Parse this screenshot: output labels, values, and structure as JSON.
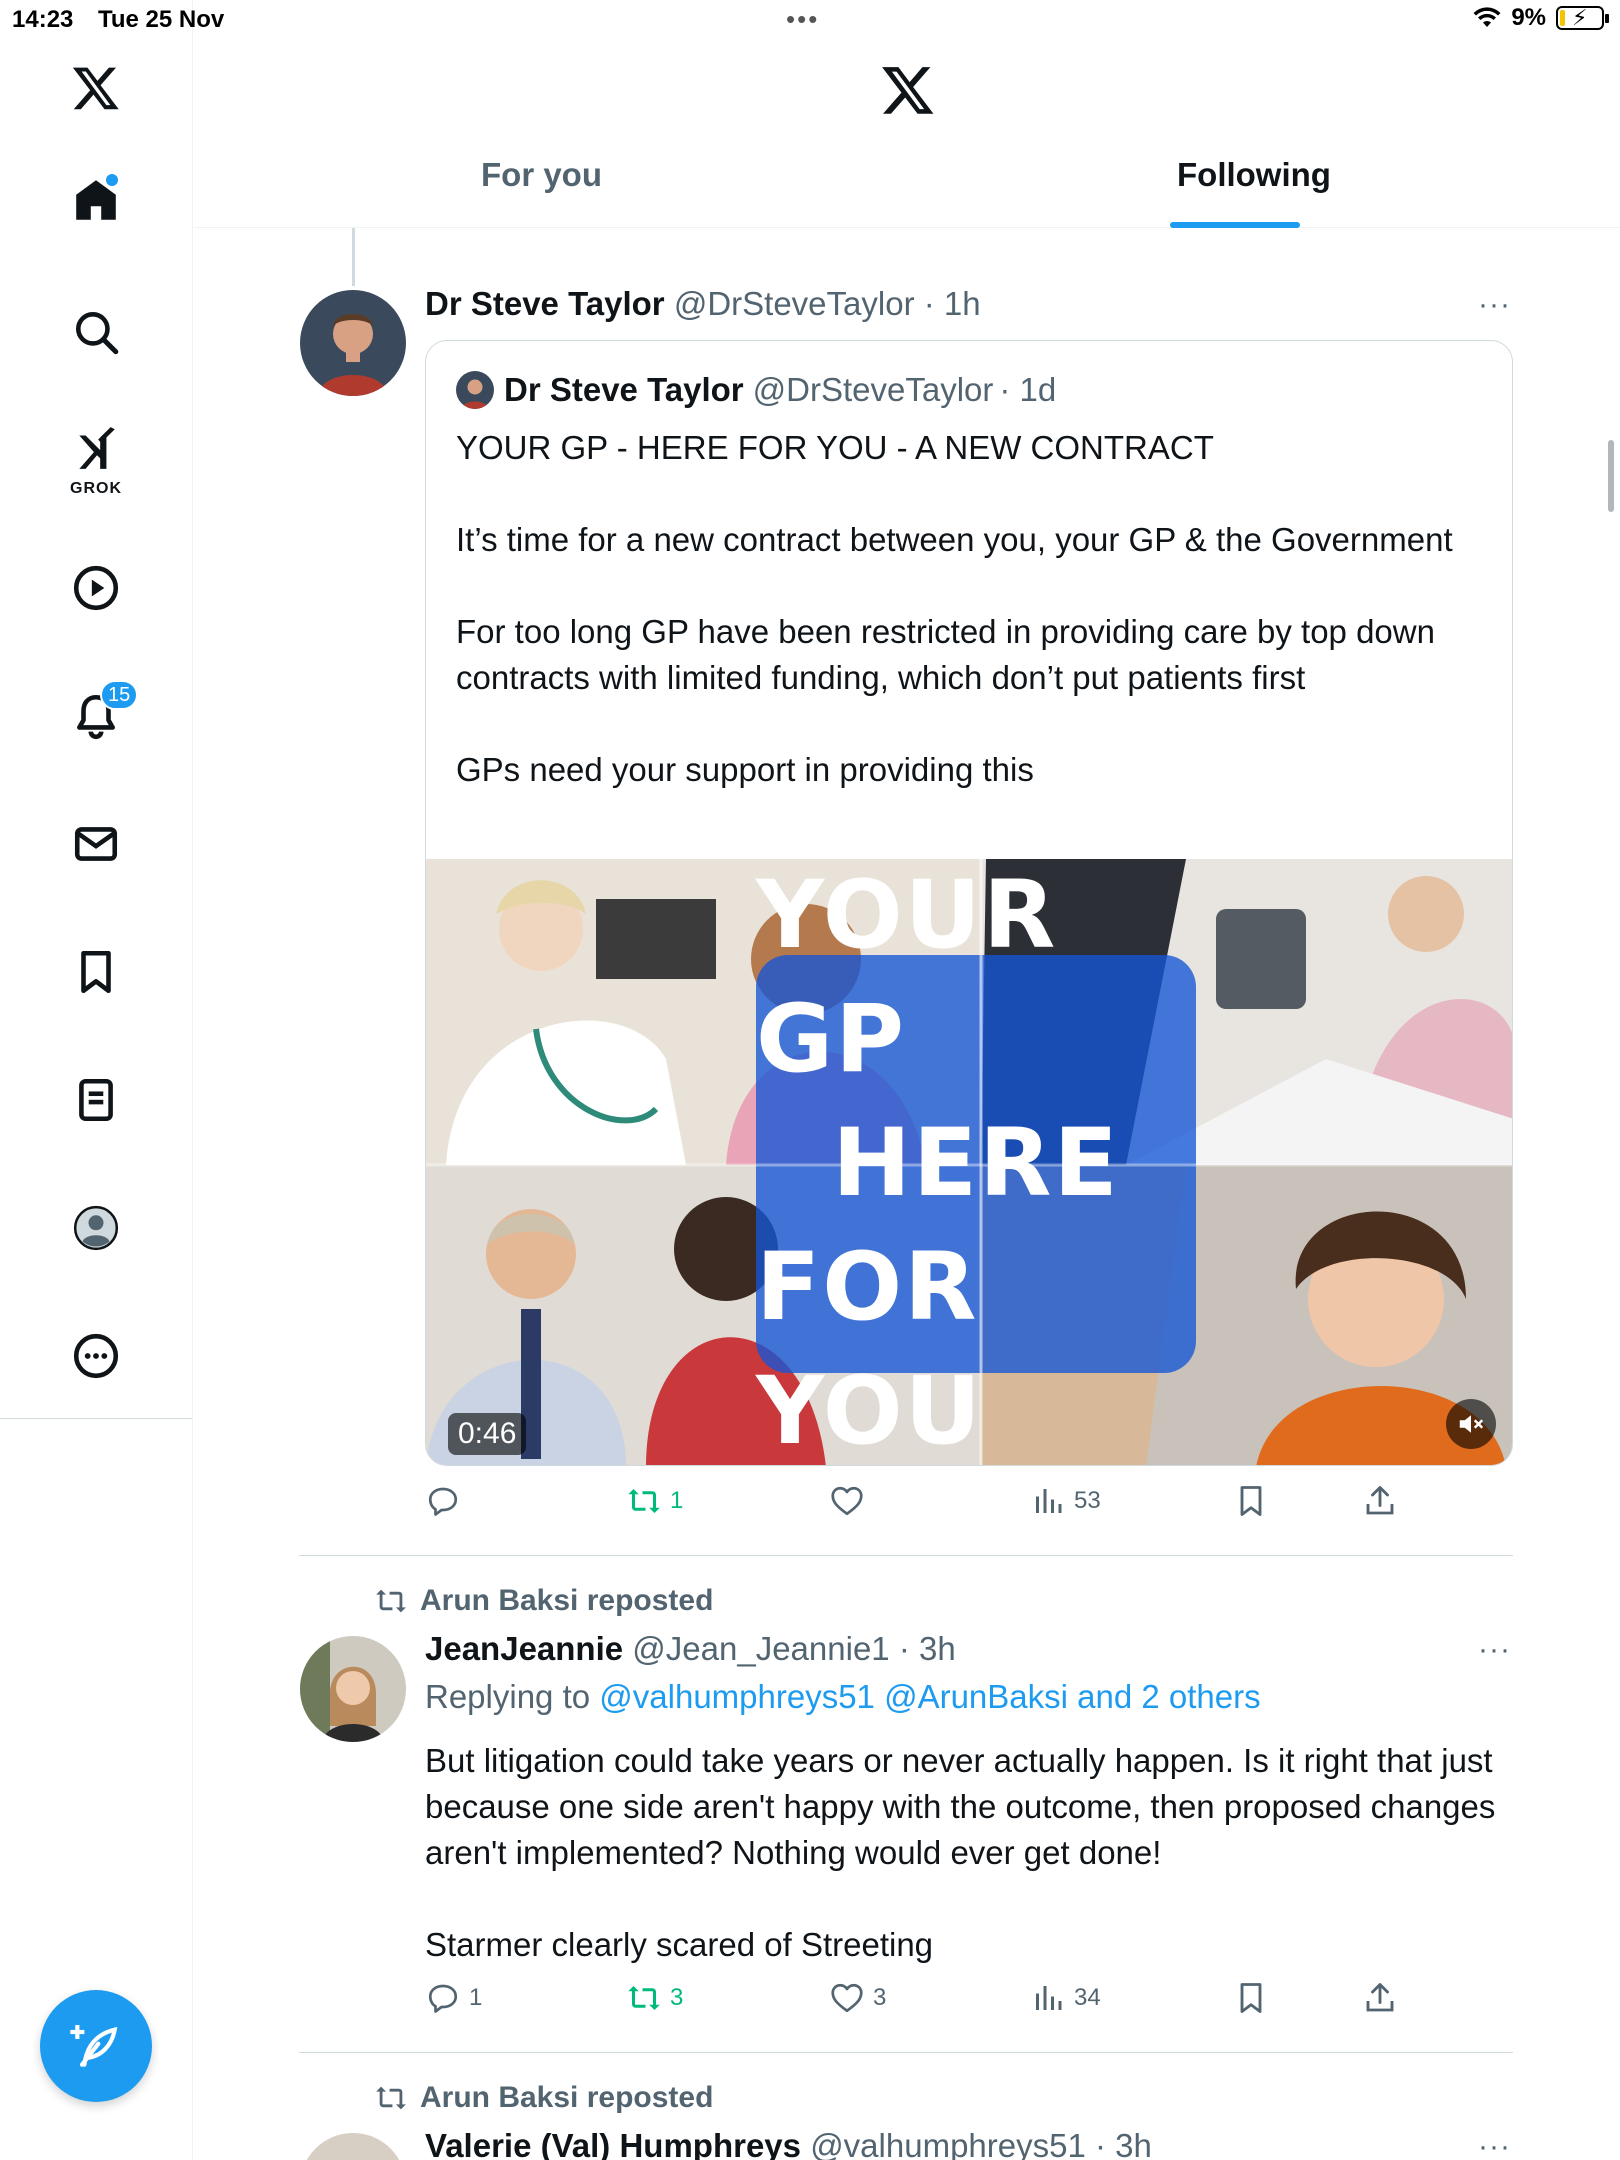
{
  "status_bar": {
    "time": "14:23",
    "date": "Tue 25 Nov",
    "battery": "9%"
  },
  "sidebar": {
    "items": [
      {
        "name": "x-logo",
        "icon": "x-logo-icon"
      },
      {
        "name": "home",
        "icon": "home-icon"
      },
      {
        "name": "explore",
        "icon": "search-icon"
      },
      {
        "name": "grok",
        "icon": "grok-icon",
        "label": "GROK"
      },
      {
        "name": "videos",
        "icon": "play-icon"
      },
      {
        "name": "notifications",
        "icon": "bell-icon",
        "badge": "15"
      },
      {
        "name": "messages",
        "icon": "mail-icon"
      },
      {
        "name": "bookmarks",
        "icon": "bookmark-icon"
      },
      {
        "name": "lists",
        "icon": "list-icon"
      },
      {
        "name": "profile",
        "icon": "profile-icon"
      },
      {
        "name": "more",
        "icon": "more-circle-icon"
      }
    ],
    "compose_icon": "compose-icon"
  },
  "header": {
    "tabs": [
      {
        "label": "For you",
        "active": false
      },
      {
        "label": "Following",
        "active": true
      }
    ]
  },
  "colors": {
    "accent": "#1d9bf0",
    "repost_green": "#00ba7c",
    "muted_text": "#536471",
    "primary_text": "#0f1419"
  },
  "feed": {
    "tweet1": {
      "name": "Dr Steve Taylor",
      "handle": "@DrSteveTaylor",
      "time": "· 1h",
      "more": "···",
      "quote": {
        "name": "Dr Steve Taylor",
        "handle": "@DrSteveTaylor",
        "time": "· 1d",
        "paragraphs": [
          "YOUR GP - HERE FOR YOU - A NEW CONTRACT",
          "It’s time for a new contract between you, your GP & the Government",
          "For too long GP have been restricted in providing care by top down contracts with limited funding, which don’t put patients first",
          "GPs need your support in providing this"
        ],
        "media": {
          "overlay_lines": [
            "YOUR GP",
            "HERE",
            "FOR YOU"
          ],
          "duration": "0:46",
          "mute_icon": "speaker-mute-icon"
        }
      },
      "actions": {
        "replies": "",
        "reposts": "1",
        "likes": "",
        "views": "53"
      }
    },
    "tweet2": {
      "reposted_by": "Arun Baksi reposted",
      "name": "JeanJeannie",
      "handle": "@Jean_Jeannie1",
      "time": "· 3h",
      "more": "···",
      "replying_prefix": "Replying to",
      "replying_links": "@valhumphreys51 @ArunBaksi and 2 others",
      "paragraphs": [
        "But litigation could take years or never actually happen. Is it right that just because one side aren't happy with the outcome, then proposed changes aren't implemented? Nothing would ever get done!",
        "Starmer clearly scared of Streeting"
      ],
      "actions": {
        "replies": "1",
        "reposts": "3",
        "likes": "3",
        "views": "34"
      }
    },
    "tweet3": {
      "reposted_by": "Arun Baksi reposted",
      "name": "Valerie (Val) Humphreys",
      "handle": "@valhumphreys51",
      "time": "· 3h",
      "more": "···"
    }
  }
}
